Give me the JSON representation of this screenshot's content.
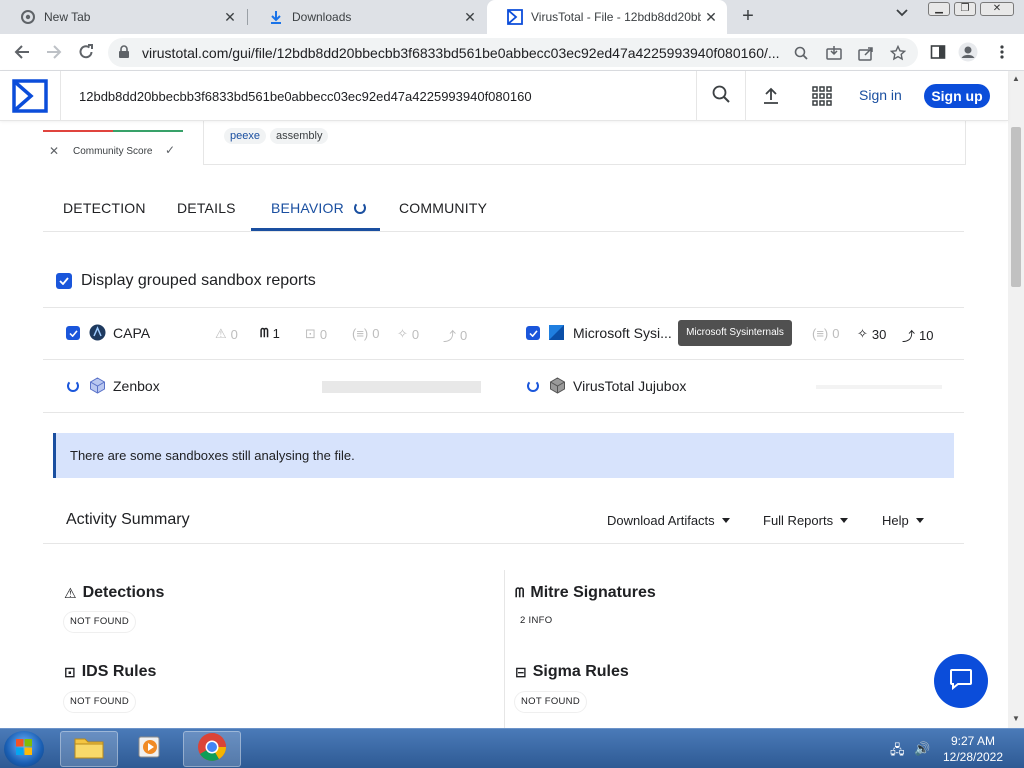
{
  "browser": {
    "tabs": [
      {
        "title": "New Tab"
      },
      {
        "title": "Downloads"
      },
      {
        "title": "VirusTotal - File - 12bdb8dd20bb"
      }
    ],
    "url": "virustotal.com/gui/file/12bdb8dd20bbecbb3f6833bd561be0abbecc03ec92ed47a4225993940f080160/..."
  },
  "vt": {
    "search_value": "12bdb8dd20bbecbb3f6833bd561be0abbecc03ec92ed47a4225993940f080160",
    "sign_in": "Sign in",
    "sign_up": "Sign up",
    "community_score_label": "Community Score",
    "tags": [
      "peexe",
      "assembly"
    ],
    "tabs": [
      "DETECTION",
      "DETAILS",
      "BEHAVIOR",
      "COMMUNITY"
    ],
    "grouped_label": "Display grouped sandbox reports",
    "sandboxes": {
      "capa": {
        "name": "CAPA",
        "metrics": [
          "0",
          "1",
          "0",
          "0",
          "0",
          "0"
        ]
      },
      "msys": {
        "name": "Microsoft Sysi...",
        "tooltip": "Microsoft Sysinternals",
        "metrics": [
          "0",
          "30",
          "10"
        ]
      },
      "zenbox": {
        "name": "Zenbox"
      },
      "jujubox": {
        "name": "VirusTotal Jujubox"
      }
    },
    "alert": "There are some sandboxes still analysing the file.",
    "activity_summary": "Activity Summary",
    "menus": [
      "Download Artifacts",
      "Full Reports",
      "Help"
    ],
    "sections": [
      {
        "title": "Detections",
        "value": "NOT FOUND"
      },
      {
        "title": "Mitre Signatures",
        "value": "2 INFO"
      },
      {
        "title": "IDS Rules",
        "value": "NOT FOUND"
      },
      {
        "title": "Sigma Rules",
        "value": "NOT FOUND"
      }
    ]
  },
  "taskbar": {
    "time": "9:27 AM",
    "date": "12/28/2022"
  },
  "colors": {
    "vt_blue": "#0b4dda",
    "accent": "#1a4fa0",
    "alert_bg": "#d7e3fc"
  }
}
